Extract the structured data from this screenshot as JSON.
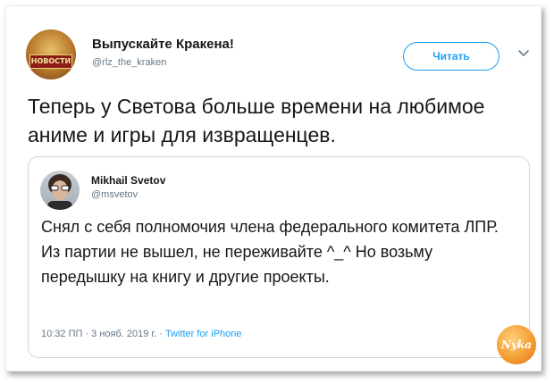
{
  "tweet": {
    "author_name": "Выпускайте Кракена!",
    "author_handle": "@rlz_the_kraken",
    "avatar_badge": "НОВОСТИ",
    "follow_label": "Читать",
    "text": "Теперь у Светова больше времени на любимое аниме и игры для извращенцев."
  },
  "quoted": {
    "author_name": "Mikhail Svetov",
    "author_handle": "@msvetov",
    "text": "Снял с себя полномочия члена федерального комитета ЛПР. Из партии не вышел, не переживайте ^_^ Но возьму передышку на книгу и другие проекты.",
    "timestamp": "10:32 ПП · 3 нояб. 2019 г. · ",
    "source": "Twitter for iPhone"
  },
  "watermark": "Nyka",
  "colors": {
    "accent": "#1da1f2",
    "text": "#14171a",
    "secondary": "#657786",
    "border": "#ccd6dd"
  },
  "icons": {
    "menu": "chevron-down-icon"
  }
}
